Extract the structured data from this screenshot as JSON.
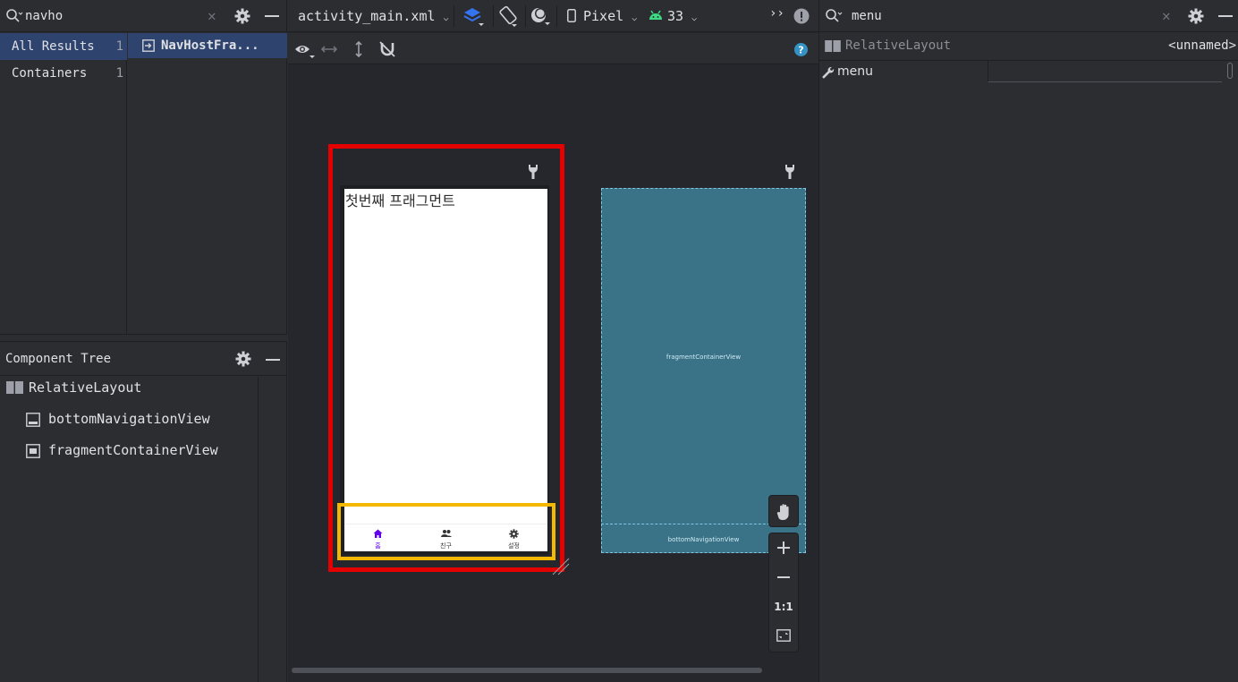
{
  "palette": {
    "search_value": "navho",
    "categories": [
      {
        "label": "All Results",
        "count": "1"
      },
      {
        "label": "Containers",
        "count": "1"
      }
    ],
    "results": [
      {
        "label": "NavHostFra..."
      }
    ]
  },
  "component_tree": {
    "title": "Component Tree",
    "nodes": [
      {
        "label": "RelativeLayout"
      },
      {
        "label": "bottomNavigationView"
      },
      {
        "label": "fragmentContainerView"
      }
    ]
  },
  "toolbar": {
    "file": "activity_main.xml",
    "device": "Pixel",
    "api_level": "33",
    "overflow": "››"
  },
  "design": {
    "fragment_text": "첫번째 프래그먼트",
    "nav_items": [
      {
        "label": "홈"
      },
      {
        "label": "친구"
      },
      {
        "label": "설정"
      }
    ],
    "blueprint_fragment_label": "fragmentContainerView",
    "blueprint_nav_label": "bottomNavigationView"
  },
  "zoom": {
    "one_to_one": "1:1"
  },
  "attributes": {
    "search_value": "menu",
    "component_type": "RelativeLayout",
    "component_id": "<unnamed>",
    "row_name": "menu",
    "row_value": ""
  },
  "colors": {
    "selection_box": "#e50000",
    "highlight_box": "#f5b800",
    "blueprint": "#3a7387",
    "accent": "#3574f0",
    "android": "#3ddc84",
    "nav_active": "#6200ee"
  }
}
